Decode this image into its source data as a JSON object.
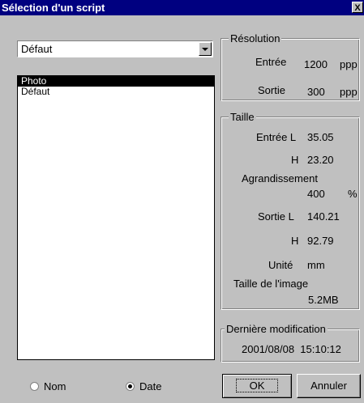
{
  "window": {
    "title": "Sélection d'un script",
    "close_label": "X"
  },
  "script_select": {
    "value": "Défaut"
  },
  "script_list": {
    "items": [
      "Photo",
      "Défaut"
    ],
    "selected_index": 0
  },
  "sort": {
    "nom_label": "Nom",
    "date_label": "Date",
    "selected": "Date"
  },
  "resolution": {
    "legend": "Résolution",
    "entree_label": "Entrée",
    "entree_value": "1200",
    "entree_unit": "ppp",
    "sortie_label": "Sortie",
    "sortie_value": "300",
    "sortie_unit": "ppp"
  },
  "taille": {
    "legend": "Taille",
    "entree_l_label": "Entrée L",
    "entree_l_value": "35.05",
    "entree_h_label": "H",
    "entree_h_value": "23.20",
    "agrandissement_label": "Agrandissement",
    "agrandissement_value": "400",
    "agrandissement_unit": "%",
    "sortie_l_label": "Sortie L",
    "sortie_l_value": "140.21",
    "sortie_h_label": "H",
    "sortie_h_value": "92.79",
    "unite_label": "Unité",
    "unite_value": "mm",
    "taille_image_label": "Taille de l'image",
    "taille_image_value": "5.2MB"
  },
  "modification": {
    "legend": "Dernière modification",
    "value": "2001/08/08  15:10:12"
  },
  "buttons": {
    "ok": "OK",
    "annuler": "Annuler"
  }
}
